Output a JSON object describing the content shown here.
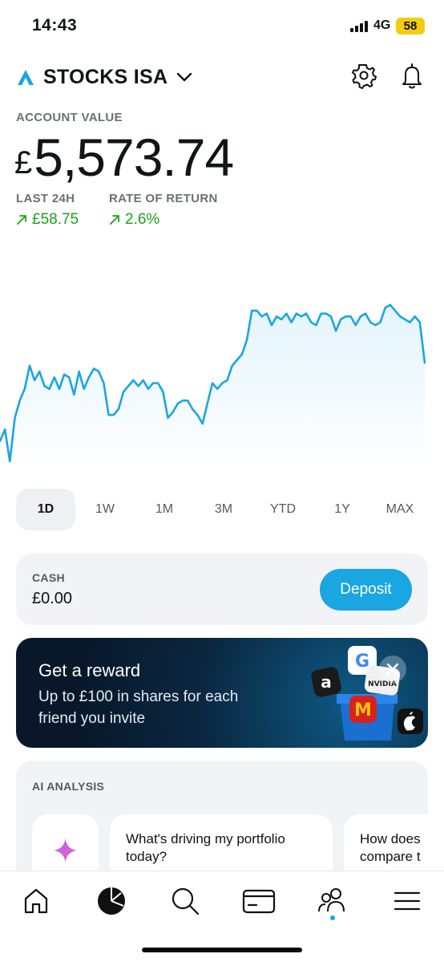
{
  "status_bar": {
    "time": "14:43",
    "network": "4G",
    "battery": "58"
  },
  "header": {
    "account_name": "STOCKS ISA",
    "logo_icon": "logo-icon",
    "accent": "#1aa6e0"
  },
  "account": {
    "value_label": "ACCOUNT VALUE",
    "currency_symbol": "£",
    "value": "5,573.74",
    "last24_label": "LAST 24H",
    "last24_value": "£58.75",
    "ror_label": "RATE OF RETURN",
    "ror_value": "2.6%",
    "positive_color": "#1aa31a"
  },
  "chart_data": {
    "type": "area",
    "title": "",
    "xlabel": "",
    "ylabel": "",
    "series": [
      {
        "values": [
          52,
          56,
          45,
          60,
          66,
          70,
          78,
          73,
          76,
          71,
          70,
          74,
          70,
          75,
          74,
          68,
          76,
          70,
          74,
          77,
          76,
          72,
          61,
          61,
          63,
          69,
          71,
          73,
          71,
          73,
          70,
          72,
          72,
          69,
          60,
          62,
          65,
          66,
          66,
          63,
          61,
          58,
          65,
          72,
          70,
          72,
          73,
          78,
          80,
          82,
          87,
          97,
          97,
          95,
          96,
          92,
          95,
          94,
          96,
          93,
          96,
          95,
          96,
          93,
          92,
          96,
          96,
          95,
          90,
          94,
          95,
          95,
          92,
          95,
          96,
          93,
          92,
          93,
          98,
          99,
          97,
          95,
          94,
          93,
          95,
          93,
          79
        ]
      }
    ],
    "line_color": "#1aa6e0",
    "grid": false
  },
  "periods": [
    {
      "label": "1D",
      "active": true
    },
    {
      "label": "1W",
      "active": false
    },
    {
      "label": "1M",
      "active": false
    },
    {
      "label": "3M",
      "active": false
    },
    {
      "label": "YTD",
      "active": false
    },
    {
      "label": "1Y",
      "active": false
    },
    {
      "label": "MAX",
      "active": false
    }
  ],
  "cash": {
    "label": "CASH",
    "value": "£0.00",
    "deposit_label": "Deposit"
  },
  "reward": {
    "title": "Get a reward",
    "text": "Up to £100 in shares for each friend you invite",
    "brands": [
      "a",
      "G",
      "NVIDIA",
      "M"
    ]
  },
  "ai_analysis": {
    "label": "AI ANALYSIS",
    "prompts": [
      "What's driving my portfolio today?",
      "How does compare t"
    ]
  },
  "nav": {
    "items": [
      "home-icon",
      "portfolio-icon",
      "search-icon",
      "card-icon",
      "community-icon",
      "menu-icon"
    ]
  }
}
